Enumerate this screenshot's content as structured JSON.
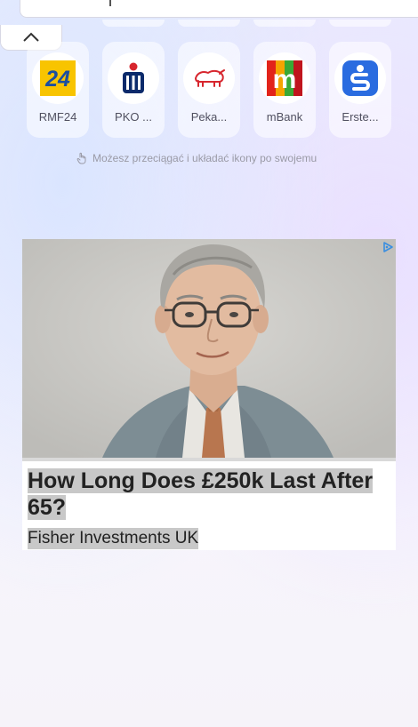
{
  "shortcuts": [
    {
      "label": "RMF24",
      "icon": "rmf24-logo"
    },
    {
      "label": "PKO ...",
      "icon": "pko-logo"
    },
    {
      "label": "Peka...",
      "icon": "pekao-logo"
    },
    {
      "label": "mBank",
      "icon": "mbank-logo"
    },
    {
      "label": "Erste...",
      "icon": "erste-logo"
    }
  ],
  "rmf24_logo_text": "24",
  "mbank_logo_text": "m",
  "hint": {
    "text": "Możesz przeciągać i układać ikony po swojemu",
    "icon": "drag-hand-icon"
  },
  "ad": {
    "headline": "How Long Does £250k Last After 65?",
    "source": "Fisher Investments UK",
    "image_alt": "watercolor portrait of an older man",
    "choices_icon": "adchoices-icon"
  },
  "colors": {
    "rmf_yellow": "#f8c400",
    "rmf_blue": "#1b4fa0",
    "pko_navy": "#0b2a6b",
    "pekao_red": "#d7262e",
    "mbank_red": "#e2231a",
    "erste_blue": "#2a6ce0"
  }
}
